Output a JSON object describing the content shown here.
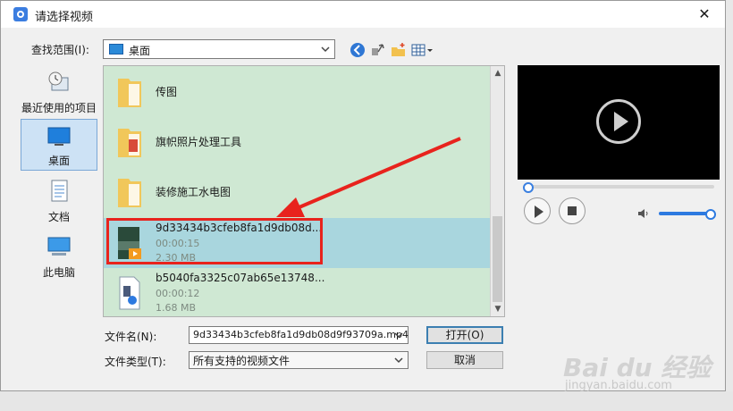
{
  "window": {
    "title": "请选择视频",
    "close_glyph": "✕"
  },
  "lookin": {
    "label": "查找范围(I):",
    "value": "桌面"
  },
  "places": [
    {
      "label": "最近使用的项目",
      "icon": "recent-items-icon"
    },
    {
      "label": "桌面",
      "icon": "desktop-icon",
      "selected": true
    },
    {
      "label": "文档",
      "icon": "documents-icon"
    },
    {
      "label": "此电脑",
      "icon": "this-pc-icon"
    }
  ],
  "files": [
    {
      "name": "传图",
      "type": "folder"
    },
    {
      "name": "旗帜照片处理工具",
      "type": "folder"
    },
    {
      "name": "装修施工水电图",
      "type": "folder"
    },
    {
      "name": "9d33434b3cfeb8fa1d9db08d...",
      "duration": "00:00:15",
      "size": "2.30 MB",
      "type": "video",
      "selected": true
    },
    {
      "name": "b5040fa3325c07ab65e13748...",
      "duration": "00:00:12",
      "size": "1.68 MB",
      "type": "media"
    }
  ],
  "filename": {
    "label": "文件名(N):",
    "value": "9d33434b3cfeb8fa1d9db08d9f93709a.mp4"
  },
  "filetype": {
    "label": "文件类型(T):",
    "value": "所有支持的视频文件"
  },
  "buttons": {
    "open": "打开(O)",
    "cancel": "取消"
  },
  "player": {
    "seek_progress": 0,
    "volume": 0.9
  },
  "watermark": {
    "text": "Bai du 经验",
    "sub": "jingyan.baidu.com"
  },
  "colors": {
    "list_bg": "#cfe8d3",
    "selection": "#a9d6de",
    "highlight_box": "#e8231d",
    "accent": "#2d7ae0"
  }
}
